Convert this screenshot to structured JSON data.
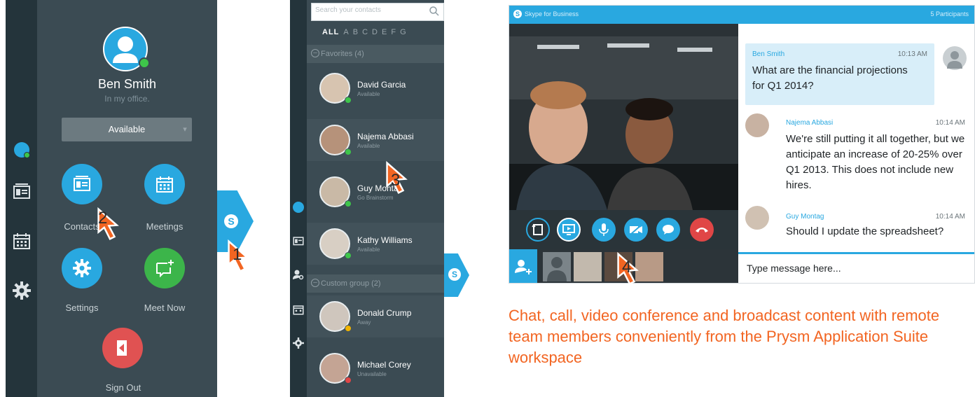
{
  "colors": {
    "accent": "#29a8e0",
    "panel": "#3b4b53",
    "rail": "#24343b",
    "available": "#3ec54a",
    "away": "#f2b400",
    "busy": "#e04646",
    "signout": "#e05252",
    "cursor": "#f26522",
    "caption": "#f26522"
  },
  "panel1": {
    "user_name": "Ben Smith",
    "status_note": "In my office.",
    "availability": "Available",
    "buttons": {
      "contacts": "Contacts",
      "meetings": "Meetings",
      "settings": "Settings",
      "meet_now": "Meet Now",
      "sign_out": "Sign Out"
    },
    "rail_icons": [
      "avatar-icon",
      "contact-card-icon",
      "calendar-icon",
      "gear-icon"
    ]
  },
  "panel2": {
    "search_placeholder": "Search your contacts",
    "alphabet": [
      "ALL",
      "A",
      "B",
      "C",
      "D",
      "E",
      "F",
      "G"
    ],
    "groups": [
      {
        "label": "Favorites (4)"
      },
      {
        "label": "Custom group (2)"
      }
    ],
    "contacts": [
      {
        "name": "David Garcia",
        "status": "Available",
        "presence": "#3ec54a"
      },
      {
        "name": "Najema Abbasi",
        "status": "Available",
        "presence": "#3ec54a"
      },
      {
        "name": "Guy Montag",
        "status": "Go Brainstorm",
        "presence": "#3ec54a"
      },
      {
        "name": "Kathy Williams",
        "status": "Available",
        "presence": "#3ec54a"
      },
      {
        "name": "Donald Crump",
        "status": "Away",
        "presence": "#f2b400"
      },
      {
        "name": "Michael Corey",
        "status": "Unavailable",
        "presence": "#e04646"
      }
    ]
  },
  "panel3": {
    "window_title": "Skype for Business",
    "participants": "5 Participants",
    "messages": [
      {
        "name": "Ben Smith",
        "time": "10:13 AM",
        "text": "What are the financial projections for Q1 2014?"
      },
      {
        "name": "Najema Abbasi",
        "time": "10:14 AM",
        "text": "We're still putting it all together, but we anticipate an increase of 20-25% over Q1 2013. This does not include new hires."
      },
      {
        "name": "Guy Montag",
        "time": "10:14 AM",
        "text": "Should I update the spreadsheet?"
      }
    ],
    "input_placeholder": "Type message here..."
  },
  "steps": [
    "1",
    "2",
    "3",
    "4"
  ],
  "caption": "Chat, call, video conference and broadcast content with remote team members conveniently from the Prysm Application Suite workspace"
}
